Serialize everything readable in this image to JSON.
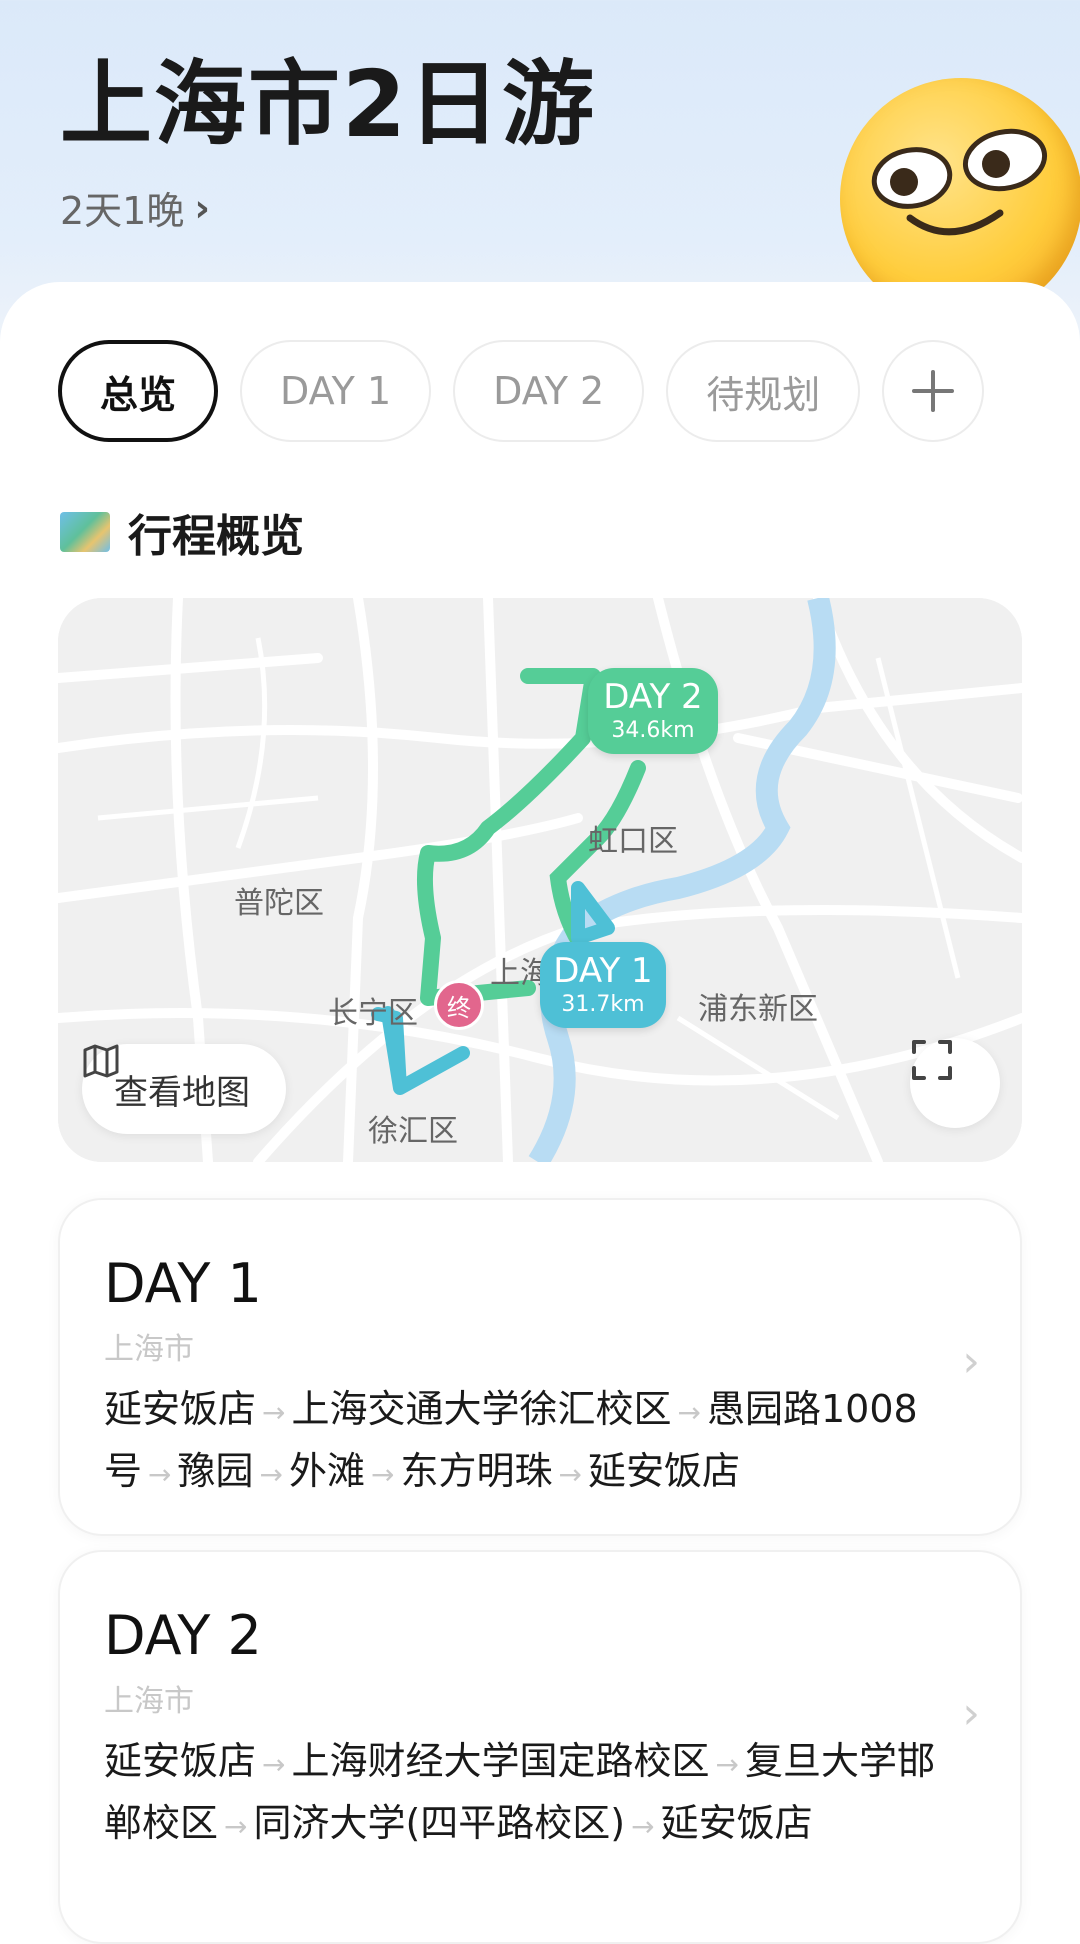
{
  "header": {
    "title": "上海市2日游",
    "subtitle": "2天1晚",
    "subtitle_chevron": "›",
    "emoji": "smirking-face"
  },
  "tabs": [
    {
      "label": "总览",
      "active": true
    },
    {
      "label": "DAY 1",
      "active": false
    },
    {
      "label": "DAY 2",
      "active": false
    },
    {
      "label": "待规划",
      "active": false
    },
    {
      "label": "+",
      "active": false
    }
  ],
  "overview": {
    "icon": "map-icon",
    "title": "行程概览"
  },
  "map": {
    "districts": [
      "普陀区",
      "虹口区",
      "长宁区",
      "浦东新区",
      "徐汇区",
      "上海",
      "上海科技"
    ],
    "day1": {
      "label": "DAY 1",
      "distance": "31.7km",
      "color": "#4ec0d6"
    },
    "day2": {
      "label": "DAY 2",
      "distance": "34.6km",
      "color": "#55cd97"
    },
    "end_marker": "终",
    "view_map_button": "查看地图",
    "river_color": "#b8dcf3"
  },
  "days": [
    {
      "title": "DAY 1",
      "city": "上海市",
      "stops": [
        "延安饭店",
        "上海交通大学徐汇校区",
        "愚园路1008号",
        "豫园",
        "外滩",
        "东方明珠",
        "延安饭店"
      ],
      "arrow": "→",
      "chevron": "›"
    },
    {
      "title": "DAY 2",
      "city": "上海市",
      "stops": [
        "延安饭店",
        "上海财经大学国定路校区",
        "复旦大学邯郸校区",
        "同济大学(四平路校区)",
        "延安饭店"
      ],
      "arrow": "→",
      "chevron": "›"
    }
  ]
}
